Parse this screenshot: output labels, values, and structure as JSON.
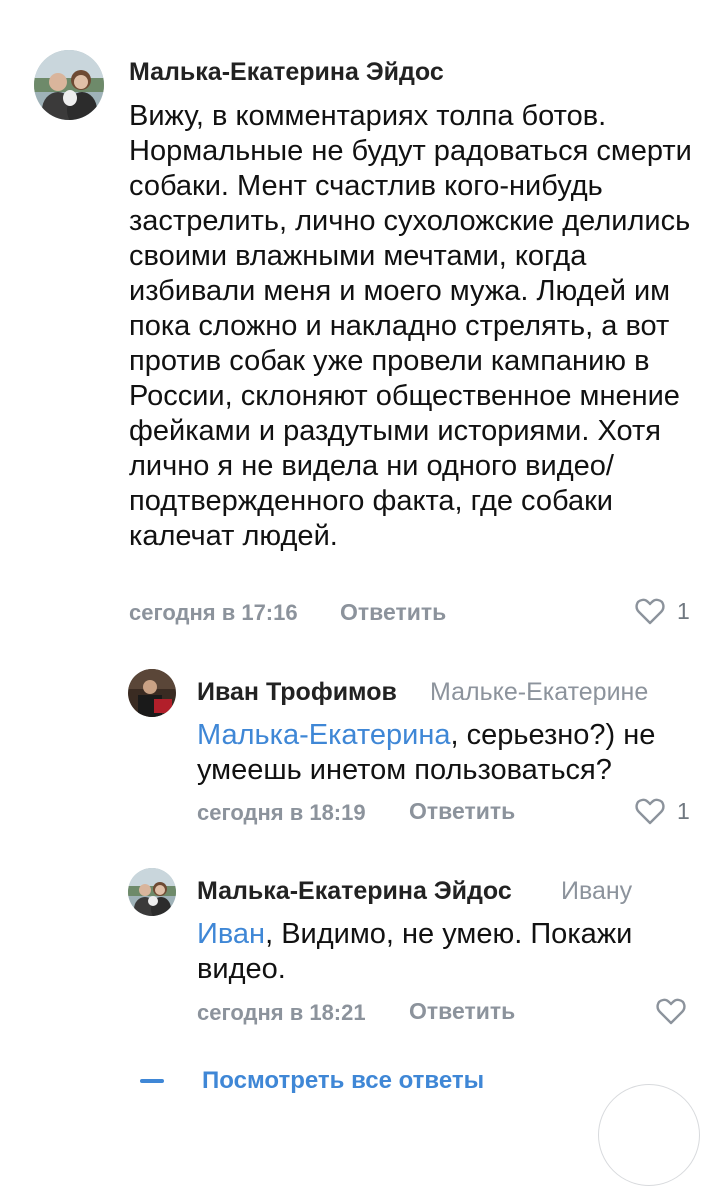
{
  "comments": [
    {
      "author": "Малька-Екатерина Эйдос",
      "reply_to": "",
      "mention": "",
      "text": "Вижу, в комментариях толпа ботов. Нормальные не будут радоваться смерти собаки. Мент счастлив кого-нибудь застрелить, лично сухоложские делились своими влажными мечтами, когда избивали меня и моего мужа. Людей им пока сложно и накладно стрелять, а вот против собак уже провели кампанию в России, склоняют общественное мнение фейками и раздутыми историями. Хотя лично я не видела ни одного видео/подтвержденного факта, где собаки калечат людей.",
      "time": "сегодня в 17:16",
      "reply_label": "Ответить",
      "likes": "1"
    },
    {
      "author": "Иван Трофимов",
      "reply_to": "Мальке-Екатерине",
      "mention": "Малька-Екатерина",
      "text": ", серьезно?) не умеешь инетом пользоваться?",
      "time": "сегодня в 18:19",
      "reply_label": "Ответить",
      "likes": "1"
    },
    {
      "author": "Малька-Екатерина Эйдос",
      "reply_to": "Ивану",
      "mention": "Иван",
      "text": ", Видимо, не умею. Покажи видео.",
      "time": "сегодня в 18:21",
      "reply_label": "Ответить",
      "likes": ""
    }
  ],
  "show_all_replies": "Посмотреть все ответы",
  "icons": {
    "like": "heart-outline-icon",
    "expand": "dash-icon"
  },
  "colors": {
    "link": "#3f87d6",
    "muted": "#8c939c"
  }
}
